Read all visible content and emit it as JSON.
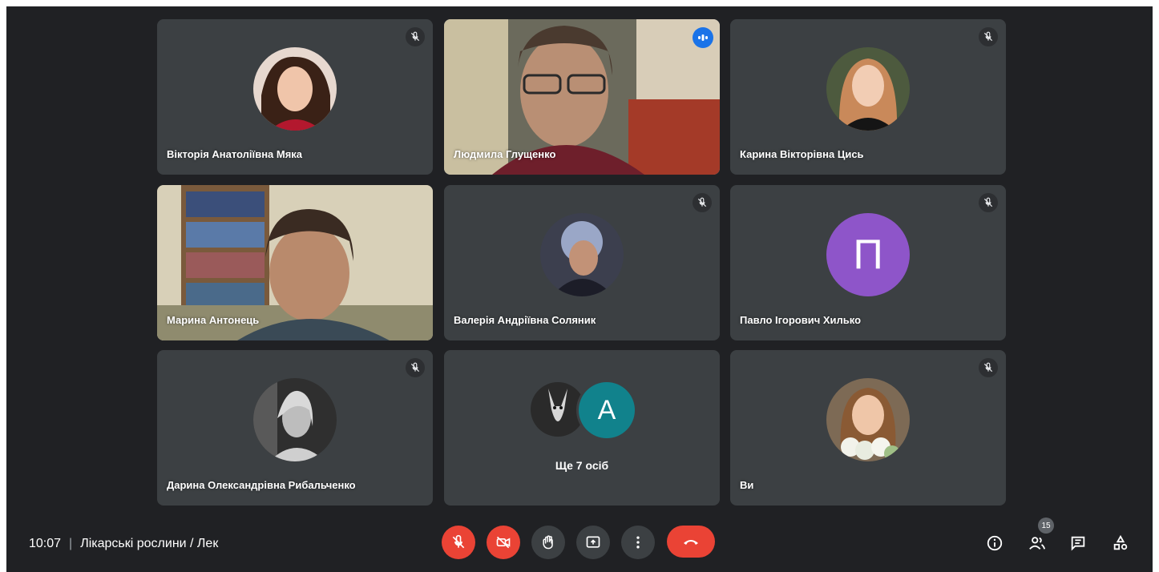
{
  "participants": [
    {
      "name": "Вікторія Анатоліївна Мяка"
    },
    {
      "name": "Людмила Глущенко"
    },
    {
      "name": "Карина Вікторівна Цись"
    },
    {
      "name": "Марина Антонець"
    },
    {
      "name": "Валерія Андріївна Соляник"
    },
    {
      "name": "Павло Ігорович Хилько",
      "letter": "П"
    },
    {
      "name": "Дарина Олександрівна Рибальченко"
    },
    {
      "more_label": "Ще 7 осіб",
      "letter": "А"
    },
    {
      "name": "Ви"
    }
  ],
  "meeting": {
    "time": "10:07",
    "separator": "|",
    "title": "Лікарські рослини / Лек"
  },
  "people_count": "15",
  "icons": {
    "mic_off": "mic-off-icon",
    "cam_off": "camera-off-icon",
    "raise_hand": "hand-icon",
    "present": "present-icon",
    "more": "more-vert-icon",
    "hangup": "call-end-icon",
    "info": "info-icon",
    "people": "people-icon",
    "chat": "chat-icon",
    "activities": "activities-icon"
  },
  "colors": {
    "background": "#202124",
    "tile": "#3c4043",
    "danger": "#ea4335",
    "speaking": "#8ab4f8",
    "avatar_purple": "#8e55c9",
    "avatar_teal": "#11828c"
  }
}
